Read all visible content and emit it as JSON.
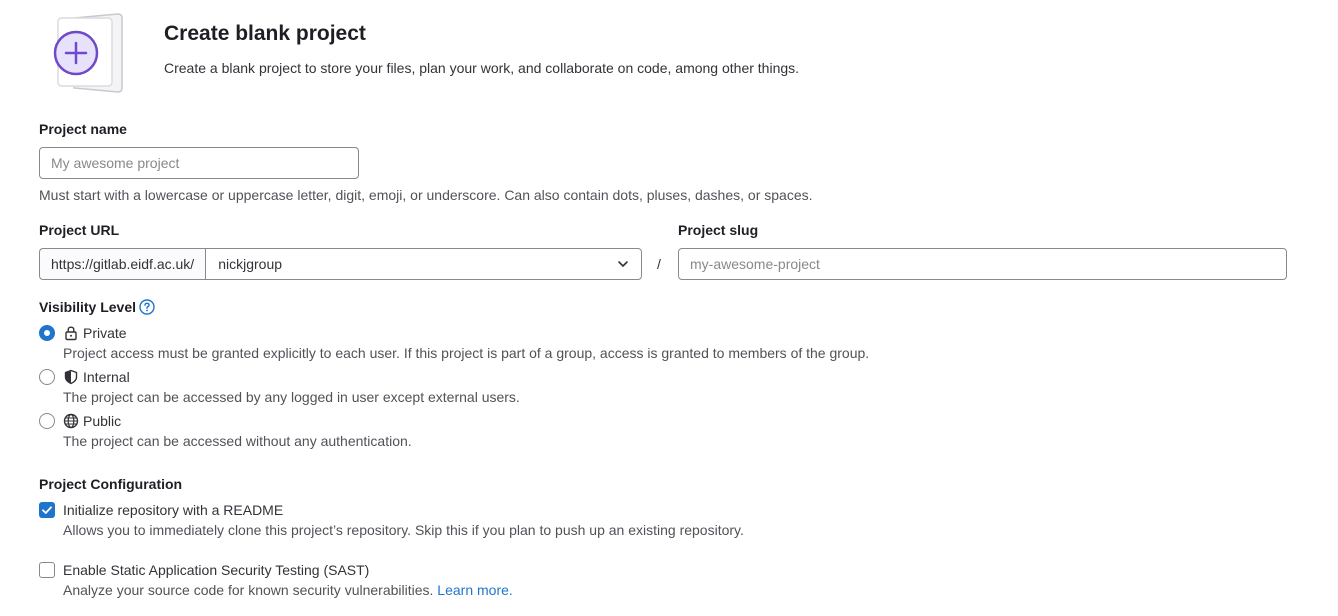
{
  "header": {
    "title": "Create blank project",
    "description": "Create a blank project to store your files, plan your work, and collaborate on code, among other things.",
    "illustration": "blank-project-plus-icon"
  },
  "project_name": {
    "label": "Project name",
    "placeholder": "My awesome project",
    "value": "",
    "help": "Must start with a lowercase or uppercase letter, digit, emoji, or underscore. Can also contain dots, pluses, dashes, or spaces."
  },
  "project_url": {
    "label": "Project URL",
    "prefix": "https://gitlab.eidf.ac.uk/",
    "namespace": "nickjgroup",
    "separator": "/"
  },
  "project_slug": {
    "label": "Project slug",
    "placeholder": "my-awesome-project",
    "value": ""
  },
  "visibility": {
    "label": "Visibility Level",
    "help_icon": "question-circle-icon",
    "options": [
      {
        "label": "Private",
        "icon": "lock-icon",
        "checked": true,
        "description": "Project access must be granted explicitly to each user. If this project is part of a group, access is granted to members of the group."
      },
      {
        "label": "Internal",
        "icon": "shield-icon",
        "checked": false,
        "description": "The project can be accessed by any logged in user except external users."
      },
      {
        "label": "Public",
        "icon": "earth-icon",
        "checked": false,
        "description": "The project can be accessed without any authentication."
      }
    ]
  },
  "configuration": {
    "label": "Project Configuration",
    "readme": {
      "label": "Initialize repository with a README",
      "checked": true,
      "description": "Allows you to immediately clone this project’s repository. Skip this if you plan to push up an existing repository."
    },
    "sast": {
      "label": "Enable Static Application Security Testing (SAST)",
      "checked": false,
      "description": "Analyze your source code for known security vulnerabilities.",
      "link": "Learn more."
    }
  },
  "colors": {
    "accent": "#1f75cb",
    "illustration_purple": "#6e49cb",
    "text": "#333238",
    "muted": "#535158"
  }
}
